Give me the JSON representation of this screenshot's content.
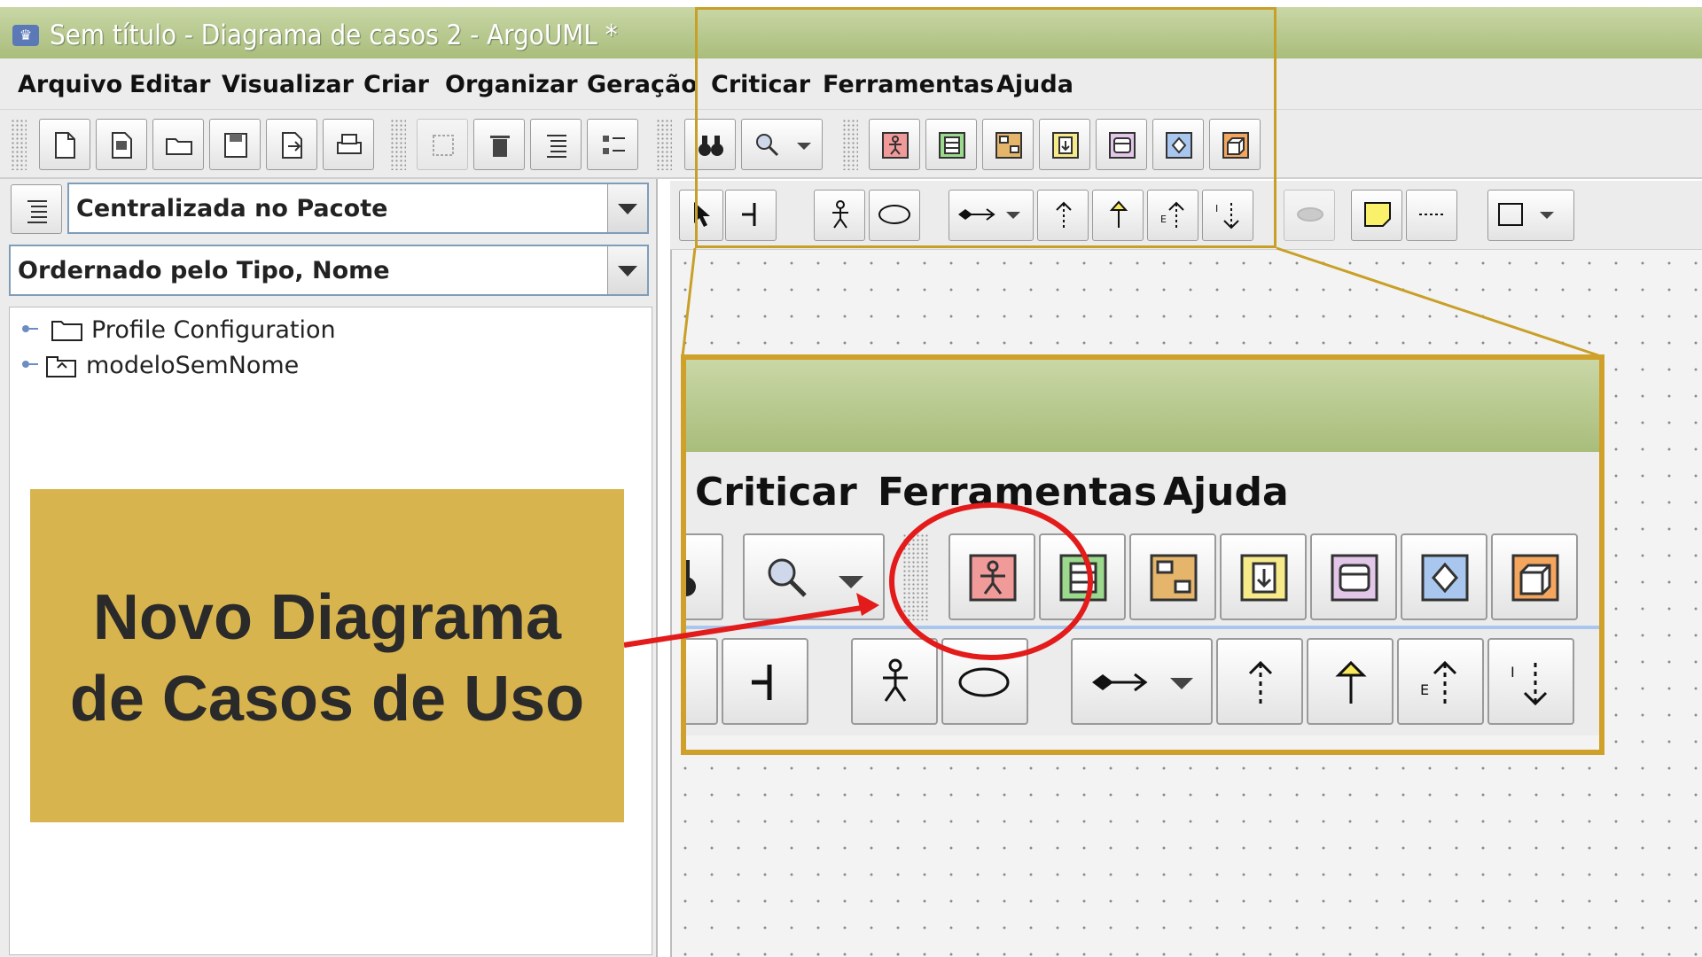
{
  "window": {
    "title": "Sem título - Diagrama de casos 2 - ArgoUML *"
  },
  "menu": [
    "Arquivo",
    "Editar",
    "Visualizar",
    "Criar",
    "Organizar",
    "Geração",
    "Criticar",
    "Ferramentas",
    "Ajuda"
  ],
  "explorer": {
    "perspective": "Centralizada no Pacote",
    "ordering": "Ordernado pelo Tipo, Nome",
    "tree": [
      "Profile Configuration",
      "modeloSemNome"
    ]
  },
  "zoom_menu": [
    "Criticar",
    "Ferramentas",
    "Ajuda"
  ],
  "callout": {
    "line1": "Novo Diagrama",
    "line2": "de Casos de Uso"
  },
  "colors": {
    "highlight": "#cfa12a",
    "annotation": "#e31b1b",
    "callout_bg": "#d8b44e",
    "titlebar": "#b5c78c"
  }
}
